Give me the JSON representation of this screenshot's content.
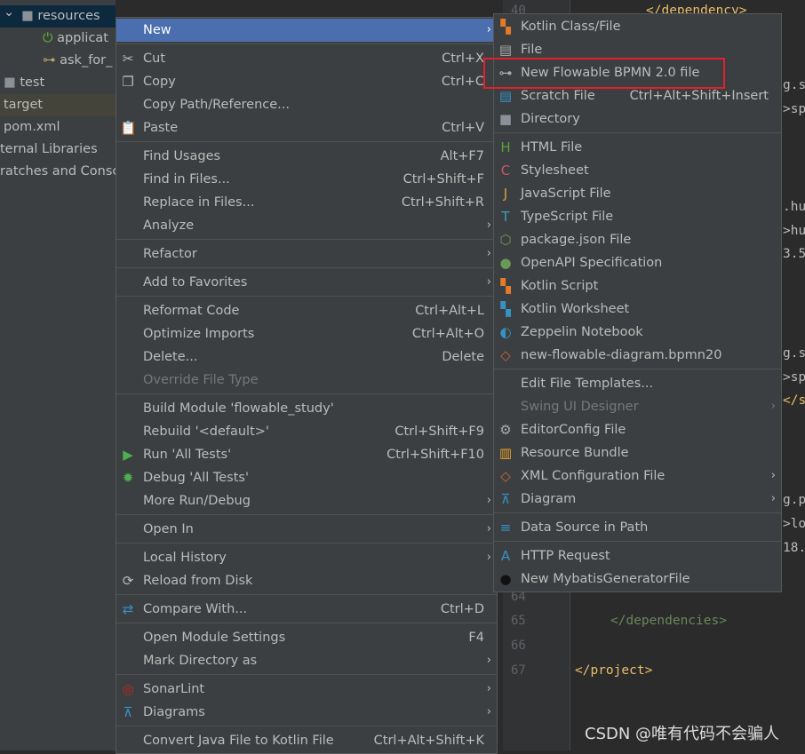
{
  "project_tree": [
    {
      "label": "resources",
      "icon": "resources-folder-icon",
      "indent": 24,
      "selected": true
    },
    {
      "label": "applicat",
      "icon": "spring-boot-icon",
      "indent": 48
    },
    {
      "label": "ask_for_",
      "icon": "bpmn-file-icon",
      "indent": 48
    },
    {
      "label": "test",
      "icon": "folder-icon",
      "indent": 4
    },
    {
      "label": "target",
      "icon": "",
      "indent": 4,
      "highlight": true
    },
    {
      "label": "pom.xml",
      "icon": "",
      "indent": 4
    },
    {
      "label": "ternal Libraries",
      "icon": "",
      "indent": 0
    },
    {
      "label": "ratches and Consc",
      "icon": "",
      "indent": 0
    }
  ],
  "editor": {
    "line_numbers": [
      "40",
      "64",
      "65",
      "66",
      "67"
    ],
    "code": [
      "</dependency>",
      "g.s",
      ">sp",
      ".hu",
      ">hu",
      "3.5",
      "g.s",
      ">sp",
      "</s",
      "g.p",
      ">lo",
      "18.",
      "</dependencies>",
      "</project>"
    ]
  },
  "context_menu": [
    {
      "label": "New",
      "submenu": true,
      "selected": true
    },
    "sep",
    {
      "label": "Cut",
      "shortcut": "Ctrl+X",
      "icon": "scissors-icon"
    },
    {
      "label": "Copy",
      "shortcut": "Ctrl+C",
      "icon": "copy-icon"
    },
    {
      "label": "Copy Path/Reference..."
    },
    {
      "label": "Paste",
      "shortcut": "Ctrl+V",
      "icon": "paste-icon"
    },
    "sep",
    {
      "label": "Find Usages",
      "shortcut": "Alt+F7"
    },
    {
      "label": "Find in Files...",
      "shortcut": "Ctrl+Shift+F"
    },
    {
      "label": "Replace in Files...",
      "shortcut": "Ctrl+Shift+R"
    },
    {
      "label": "Analyze",
      "submenu": true
    },
    "sep",
    {
      "label": "Refactor",
      "submenu": true
    },
    "sep",
    {
      "label": "Add to Favorites",
      "submenu": true
    },
    "sep",
    {
      "label": "Reformat Code",
      "shortcut": "Ctrl+Alt+L"
    },
    {
      "label": "Optimize Imports",
      "shortcut": "Ctrl+Alt+O"
    },
    {
      "label": "Delete...",
      "shortcut": "Delete"
    },
    {
      "label": "Override File Type",
      "disabled": true
    },
    "sep",
    {
      "label": "Build Module 'flowable_study'"
    },
    {
      "label": "Rebuild '<default>'",
      "shortcut": "Ctrl+Shift+F9"
    },
    {
      "label": "Run 'All Tests'",
      "shortcut": "Ctrl+Shift+F10",
      "icon": "run-icon"
    },
    {
      "label": "Debug 'All Tests'",
      "icon": "debug-icon"
    },
    {
      "label": "More Run/Debug",
      "submenu": true
    },
    "sep",
    {
      "label": "Open In",
      "submenu": true
    },
    "sep",
    {
      "label": "Local History",
      "submenu": true
    },
    {
      "label": "Reload from Disk",
      "icon": "reload-icon"
    },
    "sep",
    {
      "label": "Compare With...",
      "shortcut": "Ctrl+D",
      "icon": "compare-icon"
    },
    "sep",
    {
      "label": "Open Module Settings",
      "shortcut": "F4"
    },
    {
      "label": "Mark Directory as",
      "submenu": true
    },
    "sep",
    {
      "label": "SonarLint",
      "submenu": true,
      "icon": "sonarlint-icon"
    },
    {
      "label": "Diagrams",
      "submenu": true,
      "icon": "diagram-icon"
    },
    "sep",
    {
      "label": "Convert Java File to Kotlin File",
      "shortcut": "Ctrl+Alt+Shift+K"
    }
  ],
  "new_submenu": [
    {
      "label": "Kotlin Class/File",
      "icon": "kotlin-file-icon"
    },
    {
      "label": "File",
      "icon": "file-icon"
    },
    {
      "label": "New Flowable BPMN 2.0 file",
      "icon": "bpmn-icon",
      "highlighted": true
    },
    {
      "label": "Scratch File",
      "shortcut": "Ctrl+Alt+Shift+Insert",
      "icon": "scratch-file-icon"
    },
    {
      "label": "Directory",
      "icon": "folder-icon"
    },
    "sep",
    {
      "label": "HTML File",
      "icon": "html-file-icon"
    },
    {
      "label": "Stylesheet",
      "icon": "css-file-icon"
    },
    {
      "label": "JavaScript File",
      "icon": "js-file-icon"
    },
    {
      "label": "TypeScript File",
      "icon": "ts-file-icon"
    },
    {
      "label": "package.json File",
      "icon": "nodejs-icon"
    },
    {
      "label": "OpenAPI Specification",
      "icon": "openapi-icon"
    },
    {
      "label": "Kotlin Script",
      "icon": "kotlin-script-icon"
    },
    {
      "label": "Kotlin Worksheet",
      "icon": "kotlin-worksheet-icon"
    },
    {
      "label": "Zeppelin Notebook",
      "icon": "zeppelin-icon"
    },
    {
      "label": "new-flowable-diagram.bpmn20",
      "icon": "xml-file-icon"
    },
    "sep",
    {
      "label": "Edit File Templates..."
    },
    {
      "label": "Swing UI Designer",
      "submenu": true,
      "disabled": true
    },
    {
      "label": "EditorConfig File",
      "icon": "gear-icon"
    },
    {
      "label": "Resource Bundle",
      "icon": "resource-bundle-icon"
    },
    {
      "label": "XML Configuration File",
      "submenu": true,
      "icon": "xml-file-icon"
    },
    {
      "label": "Diagram",
      "submenu": true,
      "icon": "diagram-icon"
    },
    "sep",
    {
      "label": "Data Source in Path",
      "icon": "database-icon"
    },
    "sep",
    {
      "label": "HTTP Request",
      "icon": "api-file-icon"
    },
    {
      "label": "New MybatisGeneratorFile",
      "icon": "mybatis-icon"
    }
  ],
  "watermark": "CSDN @唯有代码不会骗人",
  "colors": {
    "selection": "#4b6eaf",
    "highlight_box": "#e0202a",
    "menu_bg": "#3c3f41"
  }
}
